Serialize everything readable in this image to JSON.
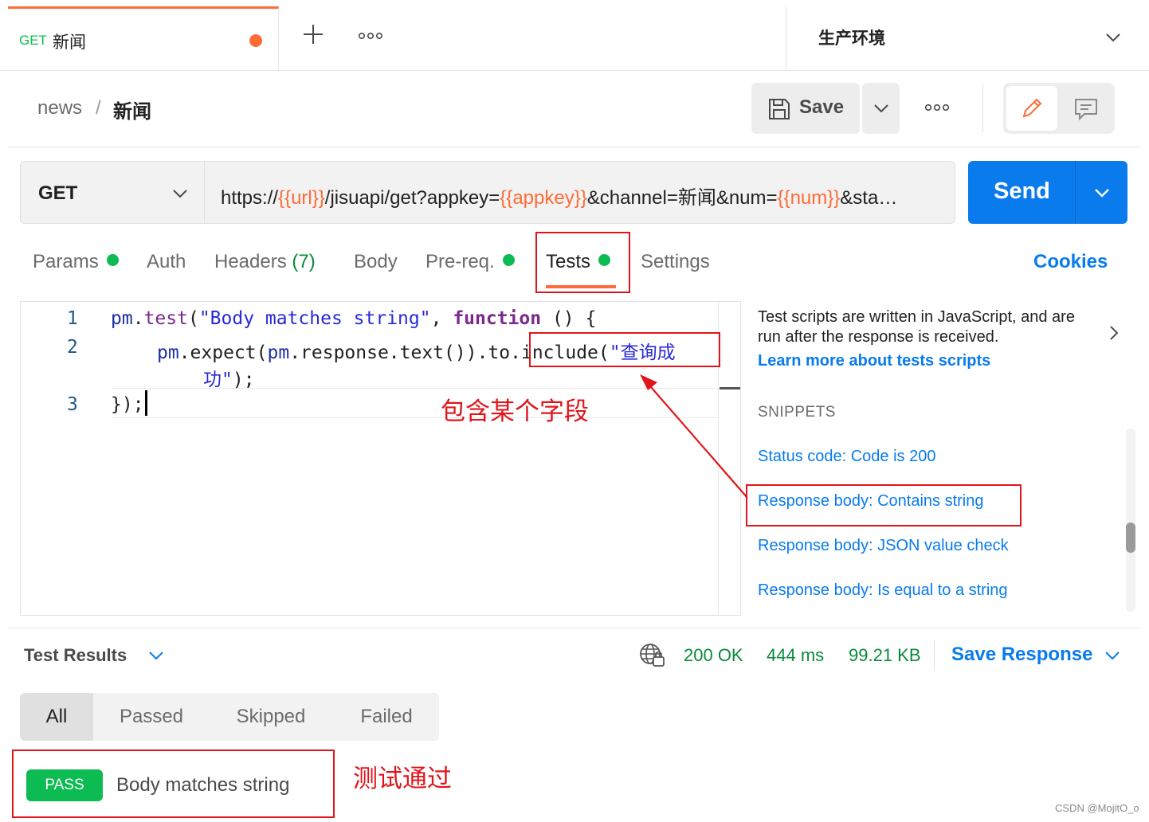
{
  "tab": {
    "method": "GET",
    "name": "新闻"
  },
  "environment": {
    "name": "生产环境"
  },
  "breadcrumb": {
    "parent": "news",
    "separator": "/",
    "current": "新闻"
  },
  "toolbar": {
    "save_label": "Save"
  },
  "request": {
    "method": "GET",
    "url_parts": [
      {
        "text": "https://",
        "var": false
      },
      {
        "text": "{{url}}",
        "var": true
      },
      {
        "text": "/jisuapi/get?appkey=",
        "var": false
      },
      {
        "text": "{{appkey}}",
        "var": true
      },
      {
        "text": "&channel=新闻&num=",
        "var": false
      },
      {
        "text": "{{num}}",
        "var": true
      },
      {
        "text": "&sta…",
        "var": false
      }
    ],
    "send_label": "Send"
  },
  "request_tabs": {
    "params": "Params",
    "auth": "Auth",
    "headers": "Headers",
    "headers_count": "(7)",
    "body": "Body",
    "prereq": "Pre-req.",
    "tests": "Tests",
    "settings": "Settings",
    "cookies": "Cookies"
  },
  "editor": {
    "line_numbers": [
      "1",
      "2",
      "3"
    ],
    "line1": {
      "a": "pm",
      "b": ".",
      "c": "test",
      "d": "(",
      "e": "\"Body matches string\"",
      "f": ", ",
      "g": "function",
      "h": " () {"
    },
    "line2": {
      "a": "pm",
      "b": ".expect(",
      "c": "pm",
      "d": ".response.text()).to.include(",
      "e": "\"查询成"
    },
    "line2_wrap": {
      "a": "功\"",
      "b": ");"
    },
    "line3": "});"
  },
  "side_panel": {
    "description": "Test scripts are written in JavaScript, and are run after the response is received.",
    "learn_more": "Learn more about tests scripts",
    "snippets_heading": "SNIPPETS",
    "snippets": [
      "Status code: Code is 200",
      "Response body: Contains string",
      "Response body: JSON value check",
      "Response body: Is equal to a string"
    ]
  },
  "response": {
    "results_title": "Test Results",
    "status": "200 OK",
    "time": "444 ms",
    "size": "99.21 KB",
    "save_response": "Save Response"
  },
  "filters": [
    "All",
    "Passed",
    "Skipped",
    "Failed"
  ],
  "results": [
    {
      "badge": "PASS",
      "name": "Body matches string"
    }
  ],
  "annotations": {
    "include_note": "包含某个字段",
    "pass_note": "测试通过"
  },
  "watermark": "CSDN @MojitO_o",
  "colors": {
    "accent": "#ff6c37",
    "brand_blue": "#097bed",
    "success": "#0cbb52",
    "annotation_red": "#e1141b"
  }
}
